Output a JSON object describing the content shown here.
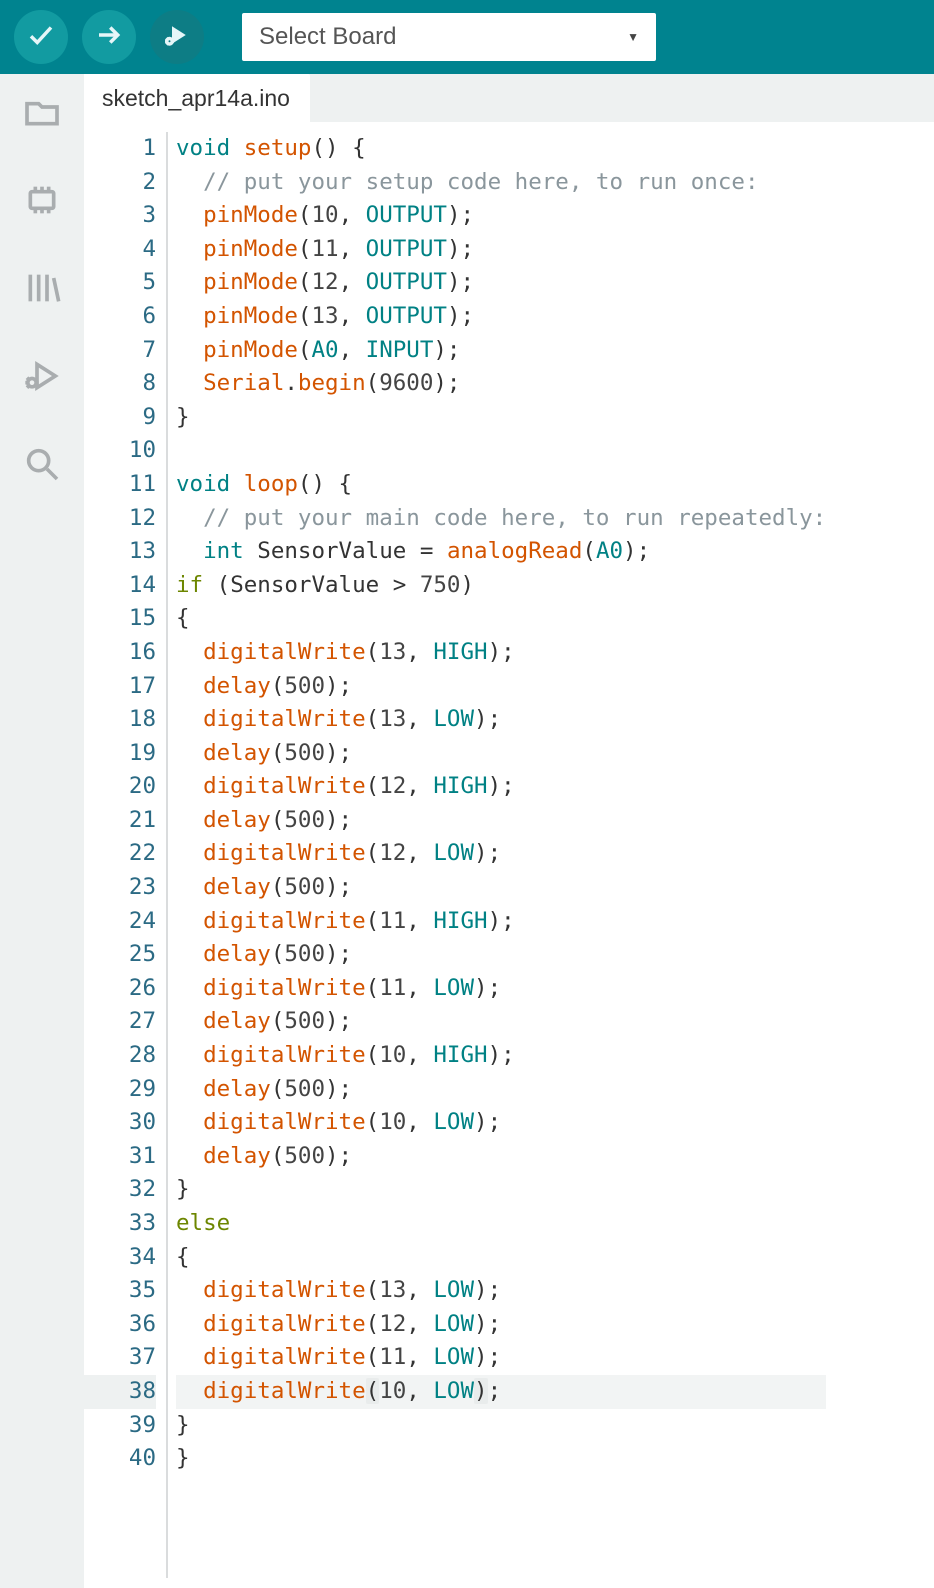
{
  "toolbar": {
    "board_select_label": "Select Board"
  },
  "sidebar": {
    "items": [
      "folder",
      "board-manager",
      "library-manager",
      "debug",
      "search"
    ]
  },
  "tabs": {
    "active": "sketch_apr14a.ino"
  },
  "editor": {
    "current_line": 38,
    "lines": [
      {
        "n": 1,
        "tokens": [
          [
            "kw-type",
            "void"
          ],
          [
            "punct",
            " "
          ],
          [
            "fn-known",
            "setup"
          ],
          [
            "punct",
            "() {"
          ]
        ]
      },
      {
        "n": 2,
        "tokens": [
          [
            "punct",
            "  "
          ],
          [
            "comment",
            "// put your setup code here, to run once:"
          ]
        ]
      },
      {
        "n": 3,
        "tokens": [
          [
            "punct",
            "  "
          ],
          [
            "fn-known",
            "pinMode"
          ],
          [
            "punct",
            "("
          ],
          [
            "num",
            "10"
          ],
          [
            "punct",
            ", "
          ],
          [
            "const",
            "OUTPUT"
          ],
          [
            "punct",
            ");"
          ]
        ]
      },
      {
        "n": 4,
        "tokens": [
          [
            "punct",
            "  "
          ],
          [
            "fn-known",
            "pinMode"
          ],
          [
            "punct",
            "("
          ],
          [
            "num",
            "11"
          ],
          [
            "punct",
            ", "
          ],
          [
            "const",
            "OUTPUT"
          ],
          [
            "punct",
            ");"
          ]
        ]
      },
      {
        "n": 5,
        "tokens": [
          [
            "punct",
            "  "
          ],
          [
            "fn-known",
            "pinMode"
          ],
          [
            "punct",
            "("
          ],
          [
            "num",
            "12"
          ],
          [
            "punct",
            ", "
          ],
          [
            "const",
            "OUTPUT"
          ],
          [
            "punct",
            ");"
          ]
        ]
      },
      {
        "n": 6,
        "tokens": [
          [
            "punct",
            "  "
          ],
          [
            "fn-known",
            "pinMode"
          ],
          [
            "punct",
            "("
          ],
          [
            "num",
            "13"
          ],
          [
            "punct",
            ", "
          ],
          [
            "const",
            "OUTPUT"
          ],
          [
            "punct",
            ");"
          ]
        ]
      },
      {
        "n": 7,
        "tokens": [
          [
            "punct",
            "  "
          ],
          [
            "fn-known",
            "pinMode"
          ],
          [
            "punct",
            "("
          ],
          [
            "const",
            "A0"
          ],
          [
            "punct",
            ", "
          ],
          [
            "const",
            "INPUT"
          ],
          [
            "punct",
            ");"
          ]
        ]
      },
      {
        "n": 8,
        "tokens": [
          [
            "punct",
            "  "
          ],
          [
            "obj",
            "Serial"
          ],
          [
            "punct",
            "."
          ],
          [
            "fn-known",
            "begin"
          ],
          [
            "punct",
            "("
          ],
          [
            "num",
            "9600"
          ],
          [
            "punct",
            ");"
          ]
        ]
      },
      {
        "n": 9,
        "tokens": [
          [
            "punct",
            "}"
          ]
        ]
      },
      {
        "n": 10,
        "tokens": [
          [
            "punct",
            ""
          ]
        ]
      },
      {
        "n": 11,
        "tokens": [
          [
            "kw-type",
            "void"
          ],
          [
            "punct",
            " "
          ],
          [
            "fn-known",
            "loop"
          ],
          [
            "punct",
            "() {"
          ]
        ]
      },
      {
        "n": 12,
        "tokens": [
          [
            "punct",
            "  "
          ],
          [
            "comment",
            "// put your main code here, to run repeatedly:"
          ]
        ]
      },
      {
        "n": 13,
        "tokens": [
          [
            "punct",
            "  "
          ],
          [
            "kw-type",
            "int"
          ],
          [
            "punct",
            " "
          ],
          [
            "ident",
            "SensorValue"
          ],
          [
            "punct",
            " = "
          ],
          [
            "fn-known",
            "analogRead"
          ],
          [
            "punct",
            "("
          ],
          [
            "const",
            "A0"
          ],
          [
            "punct",
            ");"
          ]
        ]
      },
      {
        "n": 14,
        "tokens": [
          [
            "kw-ctrl",
            "if"
          ],
          [
            "punct",
            " ("
          ],
          [
            "ident",
            "SensorValue"
          ],
          [
            "punct",
            " > "
          ],
          [
            "num",
            "750"
          ],
          [
            "punct",
            ")"
          ]
        ]
      },
      {
        "n": 15,
        "tokens": [
          [
            "punct",
            "{"
          ]
        ]
      },
      {
        "n": 16,
        "tokens": [
          [
            "punct",
            "  "
          ],
          [
            "fn-known",
            "digitalWrite"
          ],
          [
            "punct",
            "("
          ],
          [
            "num",
            "13"
          ],
          [
            "punct",
            ", "
          ],
          [
            "const",
            "HIGH"
          ],
          [
            "punct",
            ");"
          ]
        ]
      },
      {
        "n": 17,
        "tokens": [
          [
            "punct",
            "  "
          ],
          [
            "fn-known",
            "delay"
          ],
          [
            "punct",
            "("
          ],
          [
            "num",
            "500"
          ],
          [
            "punct",
            ");"
          ]
        ]
      },
      {
        "n": 18,
        "tokens": [
          [
            "punct",
            "  "
          ],
          [
            "fn-known",
            "digitalWrite"
          ],
          [
            "punct",
            "("
          ],
          [
            "num",
            "13"
          ],
          [
            "punct",
            ", "
          ],
          [
            "const",
            "LOW"
          ],
          [
            "punct",
            ");"
          ]
        ]
      },
      {
        "n": 19,
        "tokens": [
          [
            "punct",
            "  "
          ],
          [
            "fn-known",
            "delay"
          ],
          [
            "punct",
            "("
          ],
          [
            "num",
            "500"
          ],
          [
            "punct",
            ");"
          ]
        ]
      },
      {
        "n": 20,
        "tokens": [
          [
            "punct",
            "  "
          ],
          [
            "fn-known",
            "digitalWrite"
          ],
          [
            "punct",
            "("
          ],
          [
            "num",
            "12"
          ],
          [
            "punct",
            ", "
          ],
          [
            "const",
            "HIGH"
          ],
          [
            "punct",
            ");"
          ]
        ]
      },
      {
        "n": 21,
        "tokens": [
          [
            "punct",
            "  "
          ],
          [
            "fn-known",
            "delay"
          ],
          [
            "punct",
            "("
          ],
          [
            "num",
            "500"
          ],
          [
            "punct",
            ");"
          ]
        ]
      },
      {
        "n": 22,
        "tokens": [
          [
            "punct",
            "  "
          ],
          [
            "fn-known",
            "digitalWrite"
          ],
          [
            "punct",
            "("
          ],
          [
            "num",
            "12"
          ],
          [
            "punct",
            ", "
          ],
          [
            "const",
            "LOW"
          ],
          [
            "punct",
            ");"
          ]
        ]
      },
      {
        "n": 23,
        "tokens": [
          [
            "punct",
            "  "
          ],
          [
            "fn-known",
            "delay"
          ],
          [
            "punct",
            "("
          ],
          [
            "num",
            "500"
          ],
          [
            "punct",
            ");"
          ]
        ]
      },
      {
        "n": 24,
        "tokens": [
          [
            "punct",
            "  "
          ],
          [
            "fn-known",
            "digitalWrite"
          ],
          [
            "punct",
            "("
          ],
          [
            "num",
            "11"
          ],
          [
            "punct",
            ", "
          ],
          [
            "const",
            "HIGH"
          ],
          [
            "punct",
            ");"
          ]
        ]
      },
      {
        "n": 25,
        "tokens": [
          [
            "punct",
            "  "
          ],
          [
            "fn-known",
            "delay"
          ],
          [
            "punct",
            "("
          ],
          [
            "num",
            "500"
          ],
          [
            "punct",
            ");"
          ]
        ]
      },
      {
        "n": 26,
        "tokens": [
          [
            "punct",
            "  "
          ],
          [
            "fn-known",
            "digitalWrite"
          ],
          [
            "punct",
            "("
          ],
          [
            "num",
            "11"
          ],
          [
            "punct",
            ", "
          ],
          [
            "const",
            "LOW"
          ],
          [
            "punct",
            ");"
          ]
        ]
      },
      {
        "n": 27,
        "tokens": [
          [
            "punct",
            "  "
          ],
          [
            "fn-known",
            "delay"
          ],
          [
            "punct",
            "("
          ],
          [
            "num",
            "500"
          ],
          [
            "punct",
            ");"
          ]
        ]
      },
      {
        "n": 28,
        "tokens": [
          [
            "punct",
            "  "
          ],
          [
            "fn-known",
            "digitalWrite"
          ],
          [
            "punct",
            "("
          ],
          [
            "num",
            "10"
          ],
          [
            "punct",
            ", "
          ],
          [
            "const",
            "HIGH"
          ],
          [
            "punct",
            ");"
          ]
        ]
      },
      {
        "n": 29,
        "tokens": [
          [
            "punct",
            "  "
          ],
          [
            "fn-known",
            "delay"
          ],
          [
            "punct",
            "("
          ],
          [
            "num",
            "500"
          ],
          [
            "punct",
            ");"
          ]
        ]
      },
      {
        "n": 30,
        "tokens": [
          [
            "punct",
            "  "
          ],
          [
            "fn-known",
            "digitalWrite"
          ],
          [
            "punct",
            "("
          ],
          [
            "num",
            "10"
          ],
          [
            "punct",
            ", "
          ],
          [
            "const",
            "LOW"
          ],
          [
            "punct",
            ");"
          ]
        ]
      },
      {
        "n": 31,
        "tokens": [
          [
            "punct",
            "  "
          ],
          [
            "fn-known",
            "delay"
          ],
          [
            "punct",
            "("
          ],
          [
            "num",
            "500"
          ],
          [
            "punct",
            ");"
          ]
        ]
      },
      {
        "n": 32,
        "tokens": [
          [
            "punct",
            "}"
          ]
        ]
      },
      {
        "n": 33,
        "tokens": [
          [
            "kw-ctrl",
            "else"
          ]
        ]
      },
      {
        "n": 34,
        "tokens": [
          [
            "punct",
            "{"
          ]
        ]
      },
      {
        "n": 35,
        "tokens": [
          [
            "punct",
            "  "
          ],
          [
            "fn-known",
            "digitalWrite"
          ],
          [
            "punct",
            "("
          ],
          [
            "num",
            "13"
          ],
          [
            "punct",
            ", "
          ],
          [
            "const",
            "LOW"
          ],
          [
            "punct",
            ");"
          ]
        ]
      },
      {
        "n": 36,
        "tokens": [
          [
            "punct",
            "  "
          ],
          [
            "fn-known",
            "digitalWrite"
          ],
          [
            "punct",
            "("
          ],
          [
            "num",
            "12"
          ],
          [
            "punct",
            ", "
          ],
          [
            "const",
            "LOW"
          ],
          [
            "punct",
            ");"
          ]
        ]
      },
      {
        "n": 37,
        "tokens": [
          [
            "punct",
            "  "
          ],
          [
            "fn-known",
            "digitalWrite"
          ],
          [
            "punct",
            "("
          ],
          [
            "num",
            "11"
          ],
          [
            "punct",
            ", "
          ],
          [
            "const",
            "LOW"
          ],
          [
            "punct",
            ");"
          ]
        ]
      },
      {
        "n": 38,
        "tokens": [
          [
            "punct",
            "  "
          ],
          [
            "fn-known",
            "digitalWrite"
          ],
          [
            "match",
            "("
          ],
          [
            "num",
            "10"
          ],
          [
            "punct",
            ", "
          ],
          [
            "const",
            "LOW"
          ],
          [
            "match",
            ")"
          ],
          [
            "punct",
            ";"
          ]
        ]
      },
      {
        "n": 39,
        "tokens": [
          [
            "punct",
            "}"
          ]
        ]
      },
      {
        "n": 40,
        "tokens": [
          [
            "punct",
            "}"
          ]
        ]
      }
    ]
  }
}
